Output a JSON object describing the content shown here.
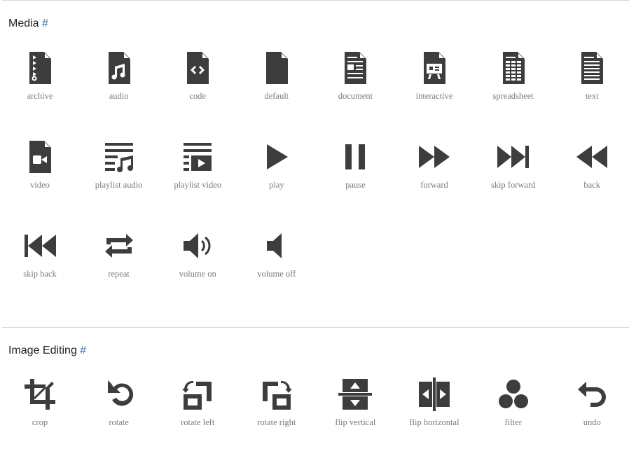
{
  "sections": [
    {
      "title": "Media",
      "anchor": "#",
      "icons": [
        {
          "label": "archive",
          "icon": "file-archive-icon"
        },
        {
          "label": "audio",
          "icon": "file-audio-icon"
        },
        {
          "label": "code",
          "icon": "file-code-icon"
        },
        {
          "label": "default",
          "icon": "file-default-icon"
        },
        {
          "label": "document",
          "icon": "file-document-icon"
        },
        {
          "label": "interactive",
          "icon": "file-interactive-icon"
        },
        {
          "label": "spreadsheet",
          "icon": "file-spreadsheet-icon"
        },
        {
          "label": "text",
          "icon": "file-text-icon"
        },
        {
          "label": "video",
          "icon": "file-video-icon"
        },
        {
          "label": "playlist audio",
          "icon": "playlist-audio-icon"
        },
        {
          "label": "playlist video",
          "icon": "playlist-video-icon"
        },
        {
          "label": "play",
          "icon": "play-icon"
        },
        {
          "label": "pause",
          "icon": "pause-icon"
        },
        {
          "label": "forward",
          "icon": "forward-icon"
        },
        {
          "label": "skip forward",
          "icon": "skip-forward-icon"
        },
        {
          "label": "back",
          "icon": "back-icon"
        },
        {
          "label": "skip back",
          "icon": "skip-back-icon"
        },
        {
          "label": "repeat",
          "icon": "repeat-icon"
        },
        {
          "label": "volume on",
          "icon": "volume-on-icon"
        },
        {
          "label": "volume off",
          "icon": "volume-off-icon"
        }
      ]
    },
    {
      "title": "Image Editing",
      "anchor": "#",
      "icons": [
        {
          "label": "crop",
          "icon": "crop-icon"
        },
        {
          "label": "rotate",
          "icon": "rotate-icon"
        },
        {
          "label": "rotate left",
          "icon": "rotate-left-icon"
        },
        {
          "label": "rotate right",
          "icon": "rotate-right-icon"
        },
        {
          "label": "flip vertical",
          "icon": "flip-vertical-icon"
        },
        {
          "label": "flip horizontal",
          "icon": "flip-horizontal-icon"
        },
        {
          "label": "filter",
          "icon": "filter-icon"
        },
        {
          "label": "undo",
          "icon": "undo-icon"
        }
      ]
    }
  ]
}
